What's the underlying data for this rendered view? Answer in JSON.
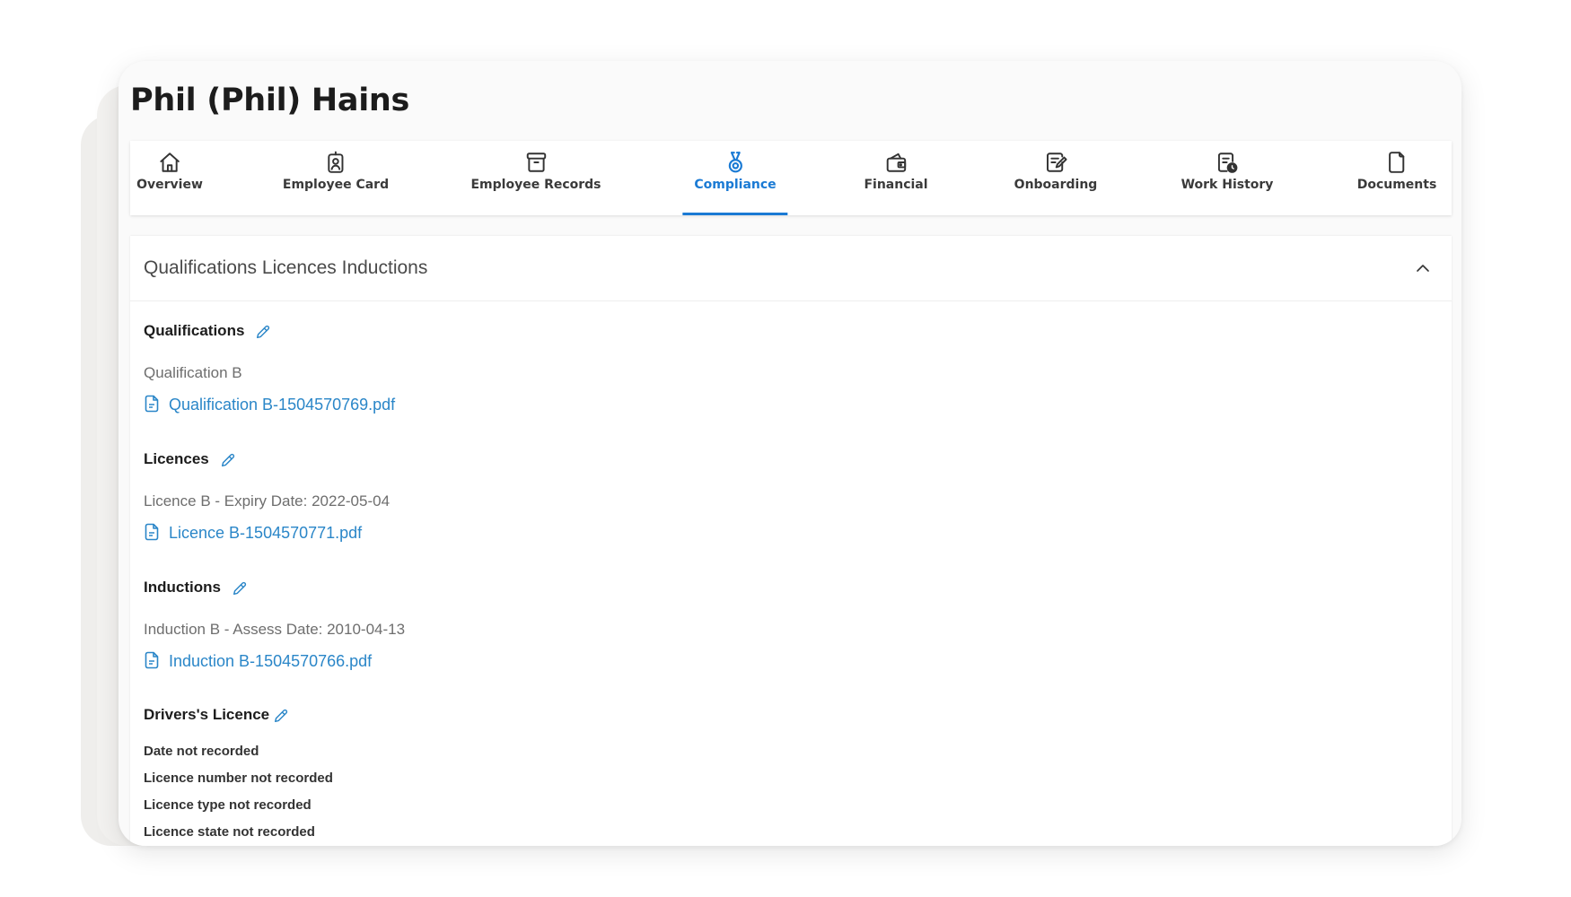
{
  "page": {
    "title": "Phil (Phil) Hains"
  },
  "tabs": [
    {
      "label": "Overview",
      "icon": "home-icon",
      "active": false
    },
    {
      "label": "Employee Card",
      "icon": "id-badge-icon",
      "active": false
    },
    {
      "label": "Employee Records",
      "icon": "archive-box-icon",
      "active": false
    },
    {
      "label": "Compliance",
      "icon": "medal-icon",
      "active": true
    },
    {
      "label": "Financial",
      "icon": "wallet-icon",
      "active": false
    },
    {
      "label": "Onboarding",
      "icon": "edit-document-icon",
      "active": false
    },
    {
      "label": "Work History",
      "icon": "document-clock-icon",
      "active": false
    },
    {
      "label": "Documents",
      "icon": "document-icon",
      "active": false
    }
  ],
  "colors": {
    "accent": "#1a7ad4",
    "link": "#2a86c8",
    "text_muted": "#6e6e6e",
    "text_dark": "#1c1c1c"
  },
  "panel": {
    "title": "Qualifications Licences Inductions",
    "expanded": true,
    "qualifications": {
      "heading": "Qualifications",
      "item": "Qualification B",
      "file": "Qualification B-1504570769.pdf"
    },
    "licences": {
      "heading": "Licences",
      "item": "Licence B - Expiry Date: 2022-05-04",
      "file": "Licence B-1504570771.pdf"
    },
    "inductions": {
      "heading": "Inductions",
      "item": "Induction B - Assess Date: 2010-04-13",
      "file": "Induction B-1504570766.pdf"
    },
    "drivers_licence": {
      "heading": "Drivers's Licence",
      "lines": [
        "Date not recorded",
        "Licence number not recorded",
        "Licence type not recorded",
        "Licence state not recorded"
      ]
    }
  }
}
